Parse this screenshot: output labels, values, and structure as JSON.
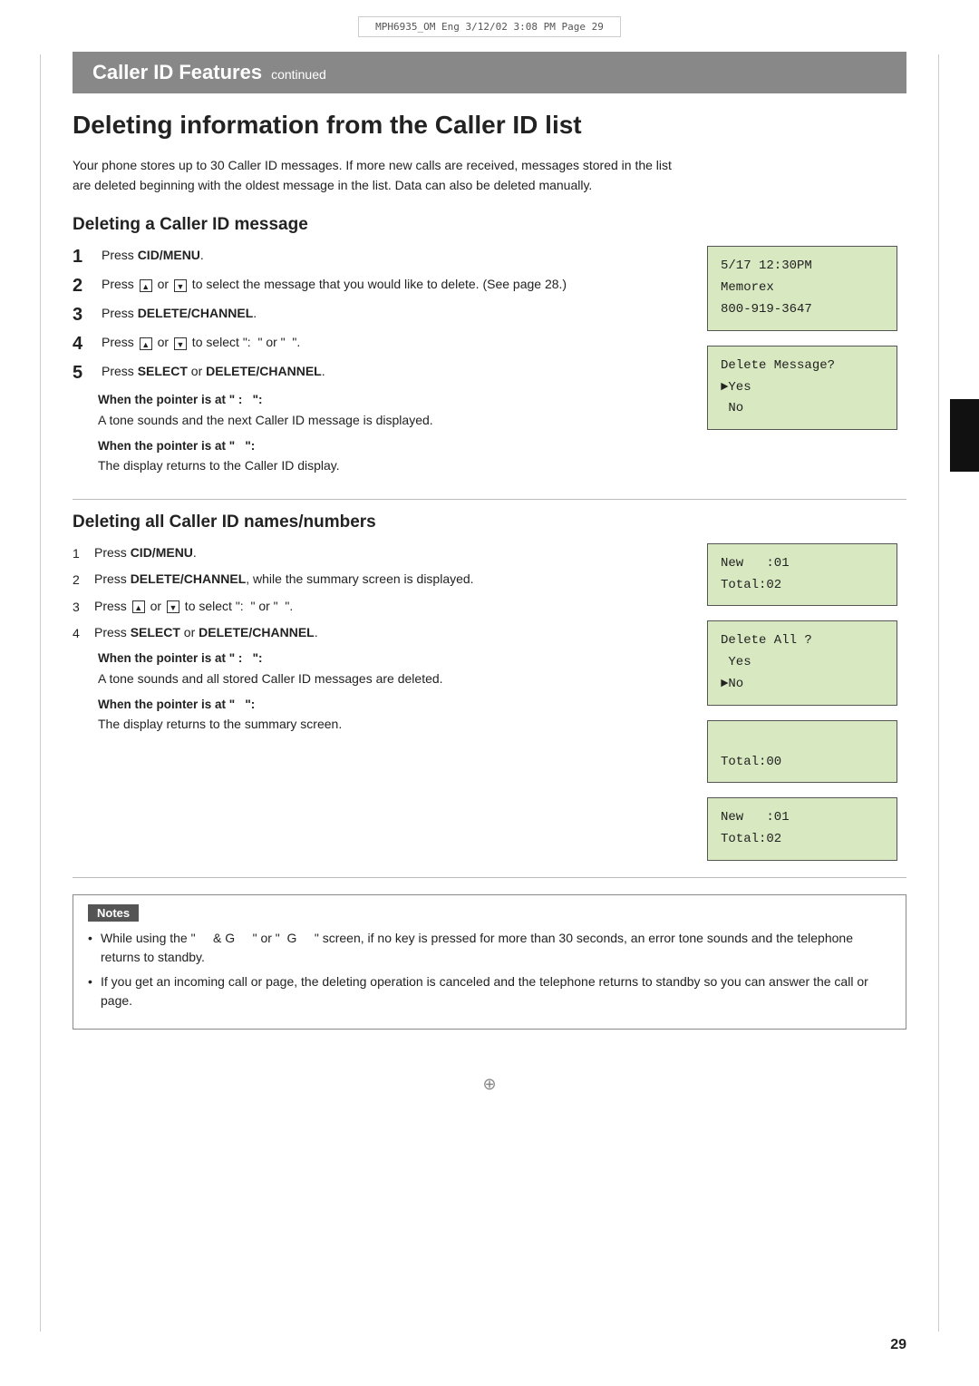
{
  "printHeader": {
    "text": "MPH6935_OM  Eng  3/12/02  3:08 PM  Page 29"
  },
  "sectionBanner": {
    "title": "Caller ID Features",
    "continued": "continued"
  },
  "pageTitle": "Deleting information from the Caller ID list",
  "introText": "Your phone stores up to 30 Caller ID messages. If more new calls are received, messages stored in the list are deleted beginning with the oldest message in the list. Data can also be deleted manually.",
  "deleteMessageSection": {
    "title": "Deleting a Caller ID message",
    "steps": [
      {
        "num": "1",
        "bold": true,
        "text": "Press ",
        "boldText": "CID/MENU",
        "after": "."
      },
      {
        "num": "2",
        "text": "Press  or   to select the message that you would like to delete. (See page 28.)"
      },
      {
        "num": "3",
        "text": "Press ",
        "boldText": "DELETE/CHANNEL",
        "after": "."
      },
      {
        "num": "4",
        "text": "Press  or  to select \": \" or \" \"."
      },
      {
        "num": "5",
        "text": "Press ",
        "boldText": "SELECT",
        "middle": " or ",
        "boldText2": "DELETE/CHANNEL",
        "after": "."
      }
    ],
    "whenPointers": [
      {
        "label": "When the pointer is at \":",
        "labelEnd": "\":",
        "desc": "A tone sounds and the next Caller ID message is displayed."
      },
      {
        "label": "When the pointer is at \"",
        "labelEnd": "\":",
        "desc": "The display returns to the Caller ID display."
      }
    ],
    "screens": [
      {
        "lines": [
          "5/17 12:30PM",
          "Memorex",
          "800-919-3647"
        ]
      },
      {
        "lines": [
          "Delete Message?",
          "►Yes",
          " No"
        ]
      }
    ]
  },
  "deleteAllSection": {
    "title": "Deleting all Caller ID names/numbers",
    "steps": [
      {
        "num": "1",
        "text": "Press ",
        "boldText": "CID/MENU",
        "after": "."
      },
      {
        "num": "2",
        "text": "Press ",
        "boldText": "DELETE/CHANNEL",
        "after": ", while the summary screen is displayed."
      },
      {
        "num": "3",
        "text": "Press  or  to select \": \" or \" \"."
      },
      {
        "num": "4",
        "text": "Press ",
        "boldText": "SELECT",
        "middle": " or ",
        "boldText2": "DELETE/CHANNEL",
        "after": "."
      }
    ],
    "whenPointers": [
      {
        "label": "When the pointer is at \":",
        "labelEnd": "\":",
        "desc": "A tone sounds and all stored Caller ID messages are deleted."
      },
      {
        "label": "When the pointer is at \"",
        "labelEnd": "\":",
        "desc": "The display returns to the summary screen."
      }
    ],
    "screens": [
      {
        "lines": [
          "New   :01",
          "Total:02"
        ]
      },
      {
        "lines": [
          "Delete All ?",
          " Yes",
          "►No"
        ]
      },
      {
        "lines": [
          "",
          "Total:00",
          ""
        ]
      },
      {
        "lines": [
          "New   :01",
          "Total:02"
        ]
      }
    ]
  },
  "notes": {
    "header": "Notes",
    "items": [
      "While using the \"  & G  \" or \" G  \" screen, if no key is pressed for more than 30 seconds, an error tone sounds and the telephone returns to standby.",
      "If you get an incoming call or page, the deleting operation is canceled and the telephone returns to standby so you can answer the call or page."
    ]
  },
  "pageNumber": "29"
}
